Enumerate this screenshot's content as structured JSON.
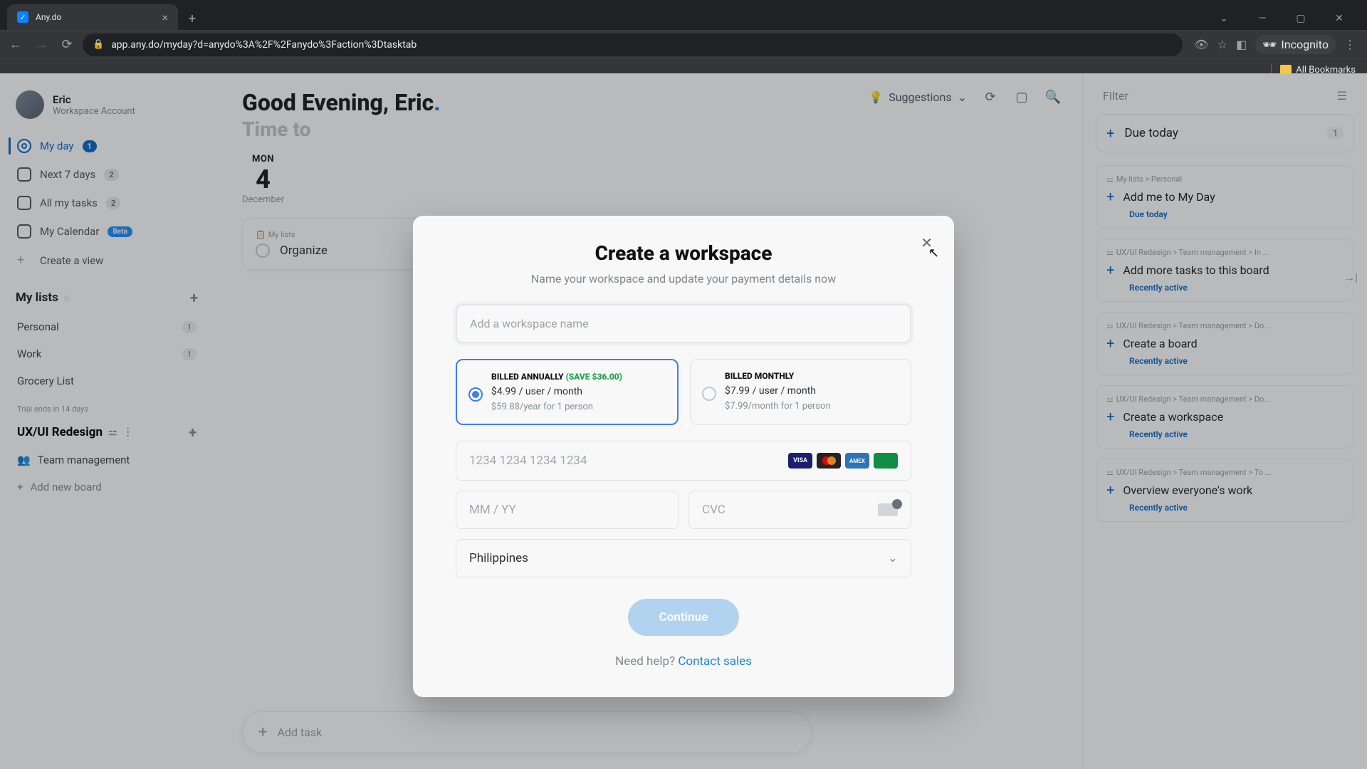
{
  "browser": {
    "tab_title": "Any.do",
    "url": "app.any.do/myday?d=anydo%3A%2F%2Fanydo%3Faction%3Dtasktab",
    "incognito_label": "Incognito",
    "all_bookmarks": "All Bookmarks"
  },
  "sidebar": {
    "profile": {
      "name": "Eric",
      "subtitle": "Workspace Account"
    },
    "nav": [
      {
        "label": "My day",
        "badge": "1",
        "active": true
      },
      {
        "label": "Next 7 days",
        "badge": "2"
      },
      {
        "label": "All my tasks",
        "badge": "2"
      },
      {
        "label": "My Calendar",
        "badge": "Beta",
        "beta": true
      },
      {
        "label": "Create a view"
      }
    ],
    "lists_header": "My lists",
    "lists": [
      {
        "label": "Personal",
        "count": "1"
      },
      {
        "label": "Work",
        "count": "1"
      },
      {
        "label": "Grocery List"
      }
    ],
    "trial": "Trial ends in 14 days",
    "workspace": "UX/UI Redesign",
    "boards": [
      {
        "emoji": "👥",
        "label": "Team management"
      }
    ],
    "add_board": "Add new board"
  },
  "main": {
    "greeting": "Good Evening, Eric",
    "subgreeting": "Time to",
    "day": {
      "dow": "MON",
      "num": "4",
      "month": "December"
    },
    "task": {
      "crumb": "My lists",
      "title": "Organize"
    },
    "add_task_placeholder": "Add task",
    "suggestions_label": "Suggestions"
  },
  "right": {
    "filter": "Filter",
    "due_today": {
      "label": "Due today",
      "count": "1"
    },
    "cards": [
      {
        "crumb": "My lists > Personal",
        "title": "Add me to My Day",
        "meta": "Due today"
      },
      {
        "crumb": "UX/UI Redesign > Team management > In ...",
        "title": "Add more tasks to this board",
        "meta": "Recently active"
      },
      {
        "crumb": "UX/UI Redesign > Team management > Do...",
        "title": "Create a board",
        "meta": "Recently active"
      },
      {
        "crumb": "UX/UI Redesign > Team management > Do...",
        "title": "Create a workspace",
        "meta": "Recently active"
      },
      {
        "crumb": "UX/UI Redesign > Team management > To ...",
        "title": "Overview everyone's work",
        "meta": "Recently active"
      }
    ]
  },
  "modal": {
    "title": "Create a workspace",
    "subtitle": "Name your workspace and update your payment details now",
    "name_placeholder": "Add a workspace name",
    "plans": {
      "annual": {
        "title": "BILLED ANNUALLY",
        "save": "(SAVE $36.00)",
        "price": "$4.99 / user / month",
        "note": "$59.88/year for 1 person"
      },
      "monthly": {
        "title": "BILLED MONTHLY",
        "price": "$7.99 / user / month",
        "note": "$7.99/month for 1 person"
      }
    },
    "card_placeholder": "1234 1234 1234 1234",
    "expiry_placeholder": "MM / YY",
    "cvc_placeholder": "CVC",
    "country": "Philippines",
    "continue": "Continue",
    "help_prefix": "Need help? ",
    "help_link": "Contact sales"
  }
}
